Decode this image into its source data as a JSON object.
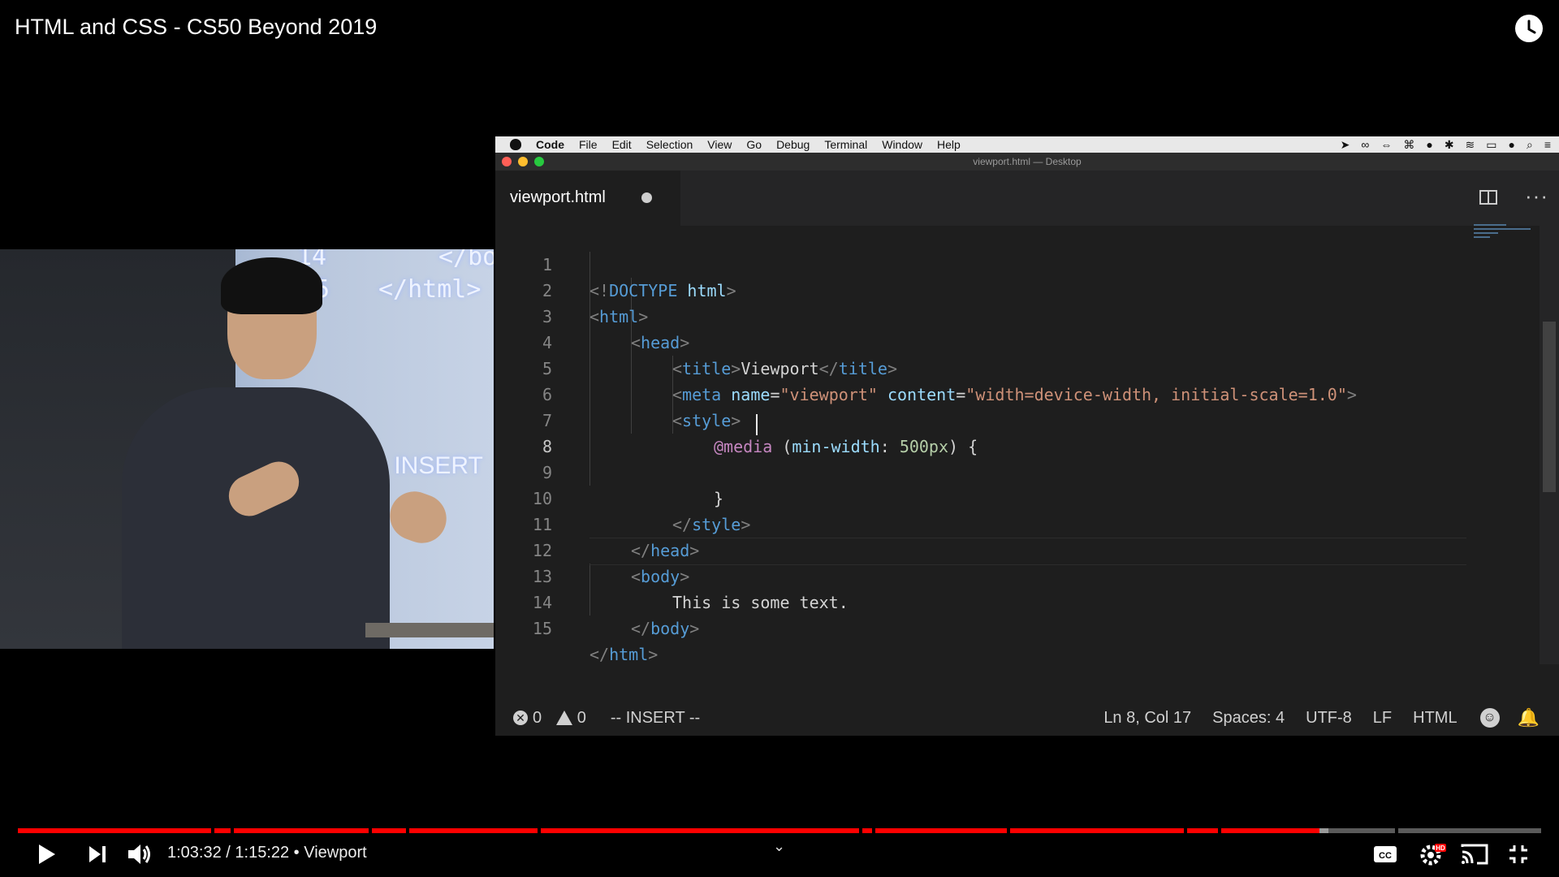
{
  "video": {
    "title": "HTML and CSS - CS50 Beyond 2019"
  },
  "camera": {
    "screen_text_1": "14",
    "screen_text_2": "</bo",
    "screen_text_3": "5",
    "screen_text_4": "</html>",
    "screen_text_5": "0  -- INSERT"
  },
  "editor": {
    "menubar": {
      "items": [
        "Code",
        "File",
        "Edit",
        "Selection",
        "View",
        "Go",
        "Debug",
        "Terminal",
        "Window",
        "Help"
      ]
    },
    "window_title": "viewport.html — Desktop",
    "tab": {
      "label": "viewport.html"
    },
    "line_numbers": [
      "1",
      "2",
      "3",
      "4",
      "5",
      "6",
      "7",
      "8",
      "9",
      "10",
      "11",
      "12",
      "13",
      "14",
      "15"
    ],
    "code": {
      "l1": {
        "a": "<!",
        "b": "DOCTYPE",
        "c": " html",
        "d": ">"
      },
      "l2": {
        "a": "<",
        "b": "html",
        "c": ">"
      },
      "l3": {
        "a": "<",
        "b": "head",
        "c": ">"
      },
      "l4": {
        "a": "<",
        "b": "title",
        "c": ">",
        "d": "Viewport",
        "e": "</",
        "f": "title",
        "g": ">"
      },
      "l5": {
        "a": "<",
        "b": "meta",
        "c": " name",
        "d": "=",
        "e": "\"viewport\"",
        "f": " content",
        "g": "=",
        "h": "\"width=device-width, initial-scale=1.0\"",
        "i": ">"
      },
      "l6": {
        "a": "<",
        "b": "style",
        "c": ">"
      },
      "l7": {
        "a": "@media",
        "b": " (",
        "c": "min-width",
        "d": ": ",
        "e": "500px",
        "f": ") {"
      },
      "l9": {
        "a": "}"
      },
      "l10": {
        "a": "</",
        "b": "style",
        "c": ">"
      },
      "l11": {
        "a": "</",
        "b": "head",
        "c": ">"
      },
      "l12": {
        "a": "<",
        "b": "body",
        "c": ">"
      },
      "l13": {
        "a": "This is some text."
      },
      "l14": {
        "a": "</",
        "b": "body",
        "c": ">"
      },
      "l15": {
        "a": "</",
        "b": "html",
        "c": ">"
      }
    },
    "status": {
      "errors": "0",
      "warnings": "0",
      "mode": "-- INSERT --",
      "position": "Ln 8, Col 17",
      "spaces": "Spaces: 4",
      "encoding": "UTF-8",
      "eol": "LF",
      "language": "HTML"
    }
  },
  "player": {
    "progress_fraction": 0.8546,
    "buffered_fraction": 0.8605,
    "time": "1:03:32 / 1:15:22 • Viewport",
    "colors": {
      "played": "#ff0000",
      "buffered": "#9a9a9a",
      "track": "#5a5a5a"
    }
  },
  "icons": [
    "watch-later-icon",
    "play-icon",
    "next-icon",
    "volume-icon",
    "chevron-down-icon",
    "captions-icon",
    "settings-icon",
    "cast-icon",
    "exit-fullscreen-icon",
    "split-editor-icon",
    "more-icon",
    "error-icon",
    "warning-icon",
    "feedback-smile-icon",
    "notification-bell-icon"
  ]
}
